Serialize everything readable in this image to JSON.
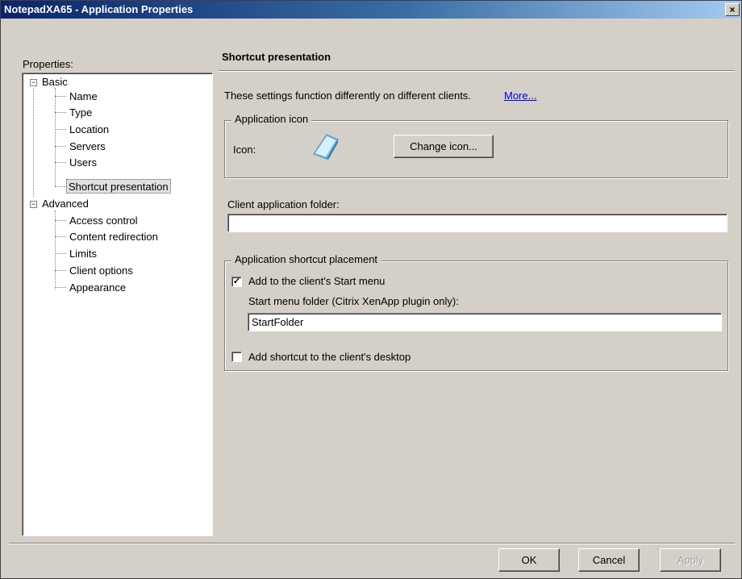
{
  "window": {
    "title": "NotepadXA65 - Application Properties",
    "close_glyph": "×"
  },
  "properties_label": "Properties:",
  "tree": {
    "basic": {
      "label": "Basic",
      "expander": "−"
    },
    "basic_items": [
      "Name",
      "Type",
      "Location",
      "Servers",
      "Users",
      "Shortcut presentation"
    ],
    "advanced": {
      "label": "Advanced",
      "expander": "−"
    },
    "advanced_items": [
      "Access control",
      "Content redirection",
      "Limits",
      "Client options",
      "Appearance"
    ],
    "selected": "Shortcut presentation"
  },
  "panel": {
    "heading": "Shortcut presentation",
    "info_text": "These settings function differently on different clients.",
    "more_link": "More...",
    "app_icon_group": {
      "legend": "Application icon",
      "icon_label": "Icon:",
      "change_button": "Change icon..."
    },
    "client_folder": {
      "label": "Client application folder:",
      "value": ""
    },
    "placement_group": {
      "legend": "Application shortcut placement",
      "start_menu_checkbox": {
        "label": "Add to the client's Start menu",
        "checked": "✓"
      },
      "start_folder_label": "Start menu folder (Citrix XenApp plugin only):",
      "start_folder_value": "StartFolder",
      "desktop_checkbox": {
        "label": "Add shortcut to the client's desktop",
        "checked": ""
      }
    }
  },
  "footer": {
    "ok": "OK",
    "cancel": "Cancel",
    "apply": "Apply"
  }
}
